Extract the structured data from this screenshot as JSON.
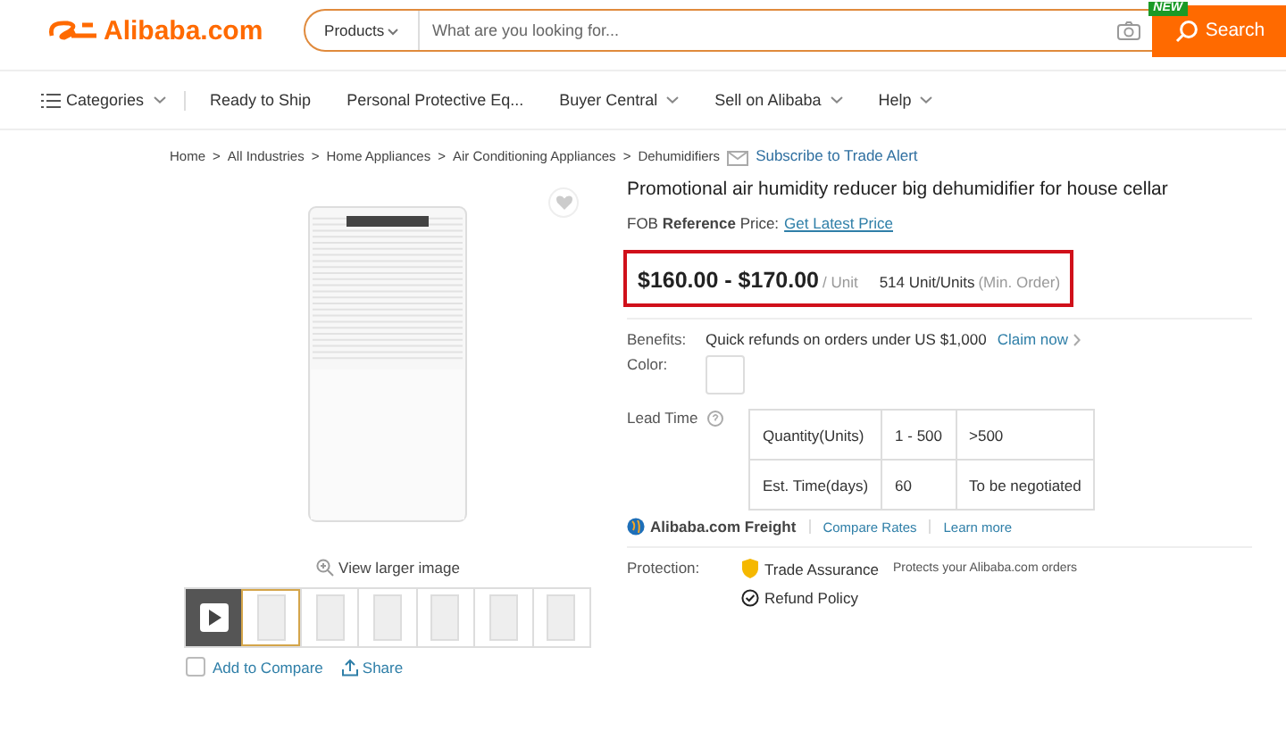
{
  "header": {
    "logo": "Alibaba.com",
    "search": {
      "category": "Products",
      "placeholder": "What are you looking for...",
      "badge": "NEW",
      "button": "Search"
    }
  },
  "nav": [
    {
      "label": "Categories",
      "kind": "menu",
      "dropdown": true
    },
    {
      "label": "Ready to Ship",
      "kind": "link",
      "dropdown": false
    },
    {
      "label": "Personal Protective Eq...",
      "kind": "link",
      "dropdown": false
    },
    {
      "label": "Buyer Central",
      "kind": "link",
      "dropdown": true
    },
    {
      "label": "Sell on Alibaba",
      "kind": "link",
      "dropdown": true
    },
    {
      "label": "Help",
      "kind": "link",
      "dropdown": true
    }
  ],
  "breadcrumb": {
    "items": [
      "Home",
      "All Industries",
      "Home Appliances",
      "Air Conditioning Appliances",
      "Dehumidifiers"
    ],
    "separator": ">",
    "alert": "Subscribe to Trade Alert"
  },
  "gallery": {
    "view_larger": "View larger image",
    "thumbnails": [
      {
        "kind": "video",
        "selected": false
      },
      {
        "kind": "image",
        "selected": true
      },
      {
        "kind": "image",
        "selected": false
      },
      {
        "kind": "image",
        "selected": false
      },
      {
        "kind": "image",
        "selected": false
      },
      {
        "kind": "image",
        "selected": false
      },
      {
        "kind": "image",
        "selected": false
      }
    ],
    "compare": {
      "label": "Add to Compare",
      "checked": false
    },
    "share": "Share"
  },
  "product": {
    "title": "Promotional air humidity reducer big dehumidifier for house cellar",
    "price_type": "FOB **Reference** Price:",
    "price_link": "Get Latest Price",
    "price": "$160.00 - $170.00",
    "unit": "/ Unit",
    "min_order": "514 Unit/Units",
    "min_order_note": "(Min. Order)",
    "benefits": {
      "label": "Benefits:",
      "text": "Quick refunds on orders under US $1,000",
      "link": "Claim now"
    },
    "color": {
      "label": "Color:"
    },
    "lead_time": {
      "label": "Lead Time",
      "rows": [
        [
          "Quantity(Units)",
          "1 - 500",
          ">500"
        ],
        [
          "Est. Time(days)",
          "60",
          "To be negotiated"
        ]
      ]
    },
    "freight": {
      "name": "Alibaba.com Freight",
      "links": [
        "Compare Rates",
        "Learn more"
      ]
    },
    "protection": {
      "label": "Protection:",
      "items": [
        {
          "kind": "assurance",
          "title": "Trade Assurance",
          "note": "Protects your Alibaba.com orders"
        },
        {
          "kind": "refund",
          "title": "Refund Policy"
        }
      ]
    }
  }
}
